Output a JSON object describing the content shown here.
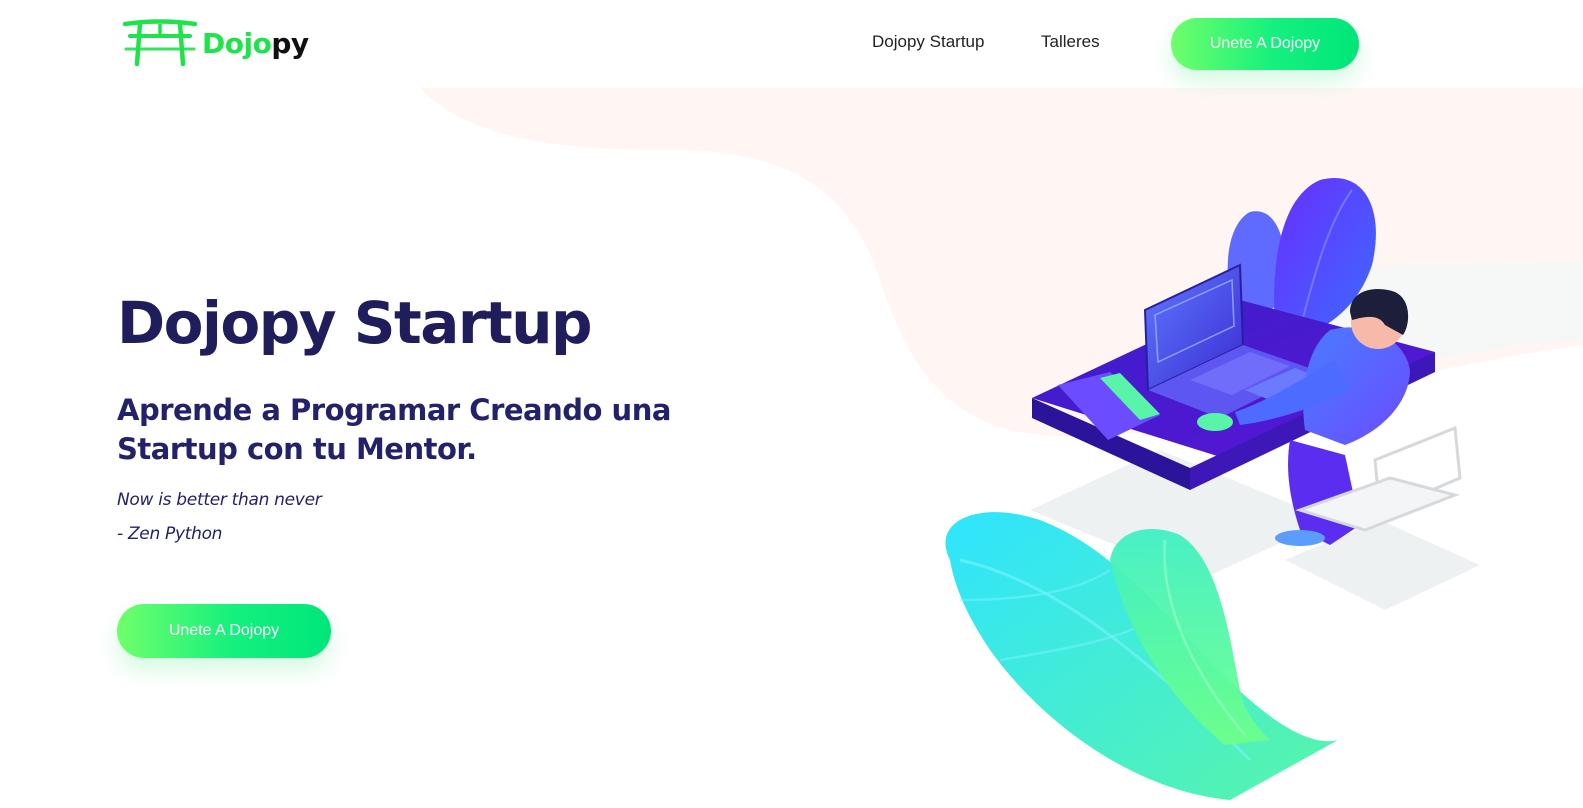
{
  "brand": {
    "logo_prefix": "Dojo",
    "logo_suffix": "py",
    "logo_icon": "torii-gate-icon",
    "accent_color": "#1ee34a",
    "text_color": "#1f1d5c"
  },
  "nav": {
    "links": [
      {
        "label": "Dojopy Startup"
      },
      {
        "label": "Talleres"
      }
    ],
    "cta_label": "Unete A Dojopy"
  },
  "hero": {
    "title": "Dojopy Startup",
    "subtitle": "Aprende a Programar Creando una Startup con tu Mentor.",
    "quote": "Now is better than never",
    "quote_author": "- Zen Python",
    "cta_label": "Unete A Dojopy",
    "illustration": "developer-at-desk-illustration"
  }
}
